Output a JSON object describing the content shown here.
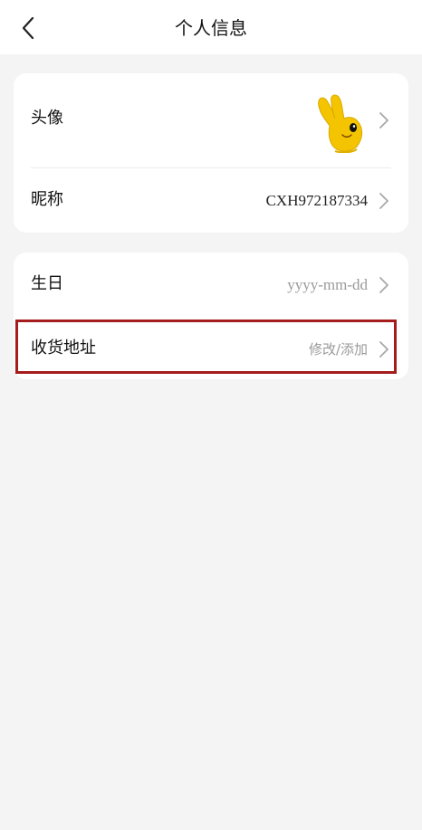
{
  "header": {
    "title": "个人信息"
  },
  "profile_card": {
    "avatar_label": "头像",
    "nickname_label": "昵称",
    "nickname_value": "CXH972187334"
  },
  "details_card": {
    "birthday_label": "生日",
    "birthday_placeholder": "yyyy-mm-dd",
    "address_label": "收货地址",
    "address_value": "修改/添加"
  },
  "colors": {
    "background": "#f4f4f5",
    "card": "#ffffff",
    "highlight_border": "#a51c1c",
    "avatar_yellow": "#f5c400"
  }
}
